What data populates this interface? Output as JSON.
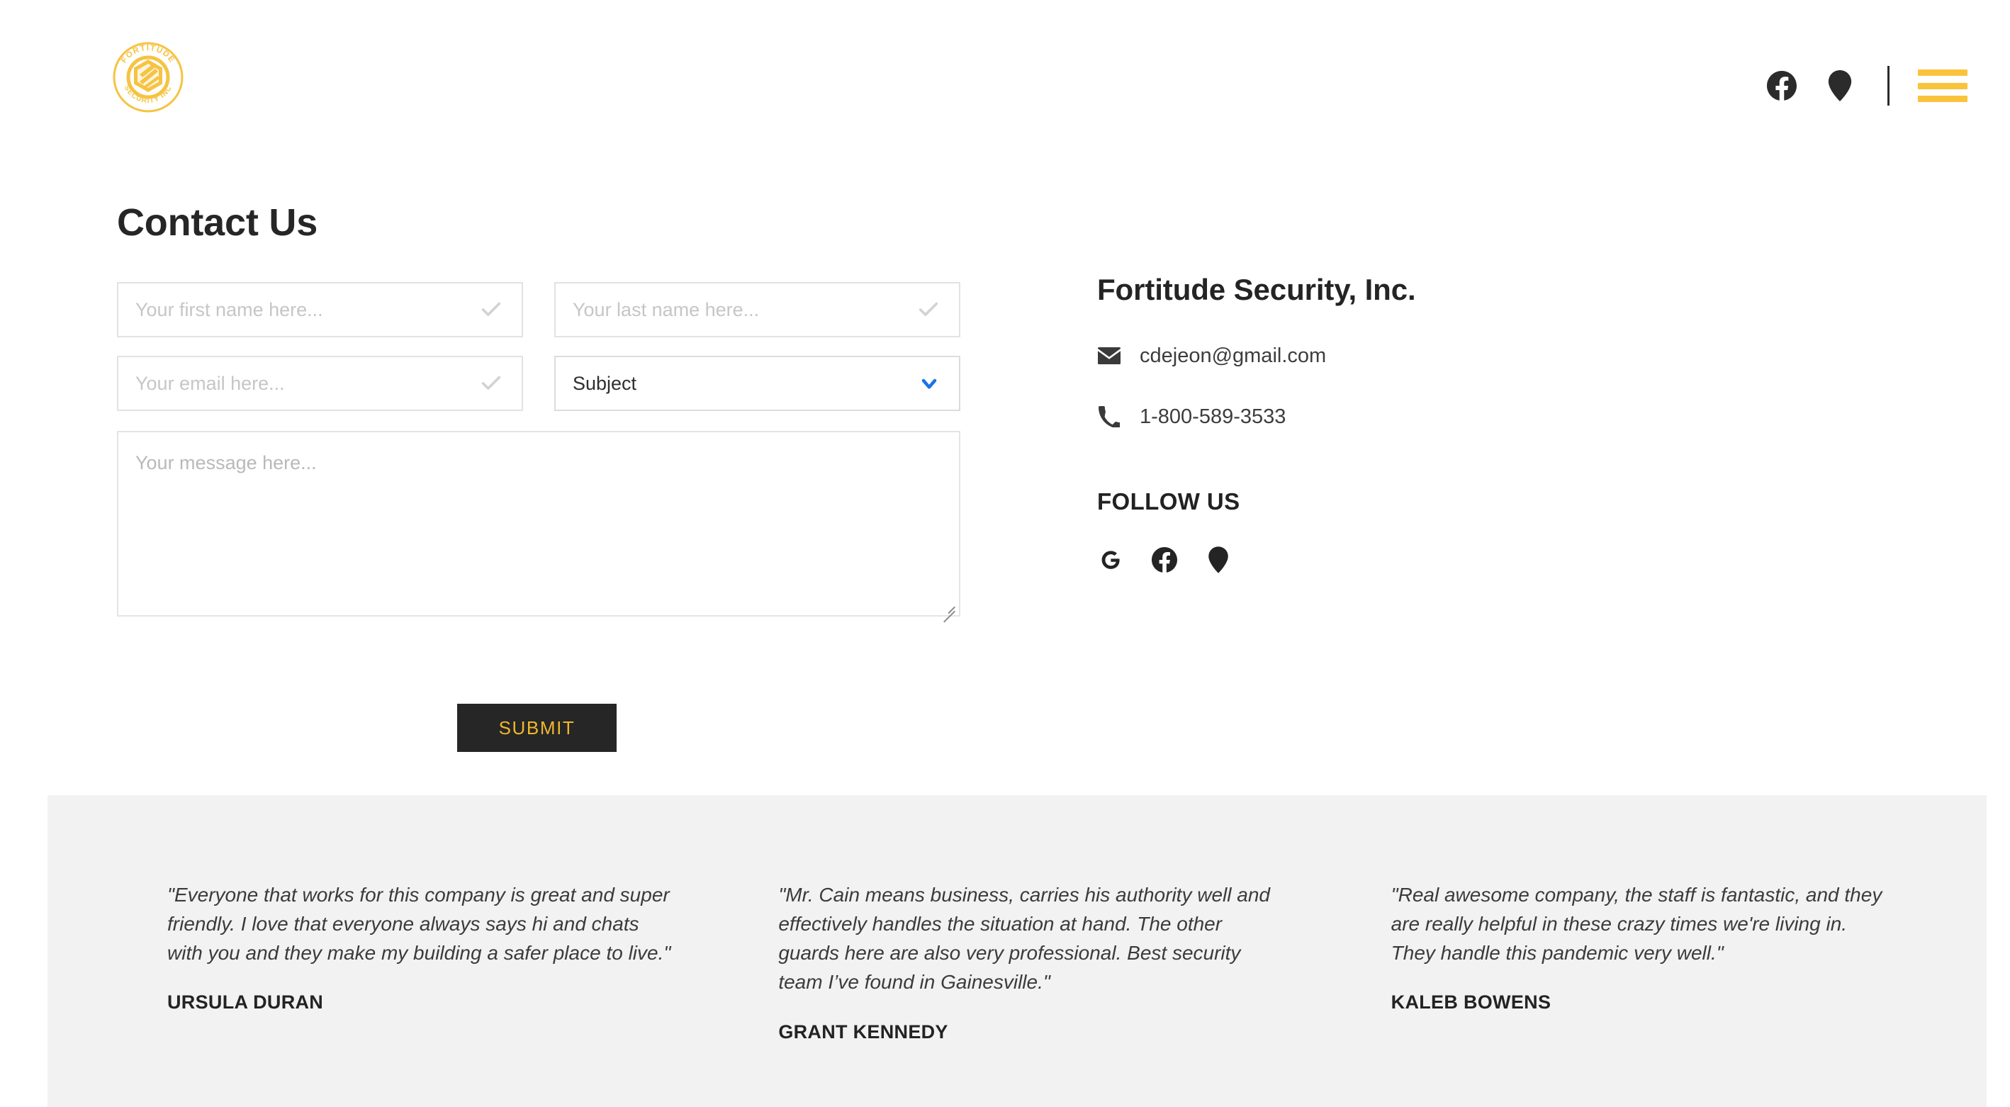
{
  "header": {
    "logo": {
      "top_arc_text": "FORTITUDE",
      "bottom_arc_text": "SECURITY INC",
      "color": "#f6c342"
    },
    "icons": {
      "facebook": "facebook-icon",
      "map_pin": "map-pin-icon",
      "menu": "hamburger-menu-icon"
    },
    "accent_color": "#fac33c"
  },
  "main": {
    "page_title": "Contact Us",
    "form": {
      "first_name_placeholder": "Your first name here...",
      "last_name_placeholder": "Your last name here...",
      "email_placeholder": "Your email here...",
      "subject_value": "Subject",
      "message_placeholder": "Your message here...",
      "submit_label": "SUBMIT",
      "first_name_value": "",
      "last_name_value": "",
      "email_value": "",
      "message_value": "",
      "valid_icon": "check-icon",
      "dropdown_icon": "chevron-down-icon",
      "dropdown_icon_color": "#1a73e8",
      "submit_bg": "#262626",
      "submit_text_color": "#f0b72c"
    }
  },
  "info": {
    "company_name": "Fortitude Security, Inc.",
    "email": "cdejeon@gmail.com",
    "phone": "1-800-589-3533",
    "email_icon": "envelope-icon",
    "phone_icon": "phone-icon",
    "follow_heading": "FOLLOW US",
    "social": [
      {
        "name": "google-icon",
        "label": "Google"
      },
      {
        "name": "facebook-icon",
        "label": "Facebook"
      },
      {
        "name": "map-pin-icon",
        "label": "Map"
      }
    ]
  },
  "testimonials": {
    "background": "#f2f2f2",
    "items": [
      {
        "quote": "\"Everyone that works for this company is great and super friendly. I love that everyone always says hi and chats with you and they make my building a safer place to live.\"",
        "author": "URSULA DURAN"
      },
      {
        "quote": "\"Mr. Cain means business, carries his authority well and effectively handles the situation at hand. The other guards here are also very professional. Best security team I’ve found in Gainesville.\"",
        "author": "GRANT KENNEDY"
      },
      {
        "quote": "\"Real awesome company, the staff is fantastic, and they are really helpful in these crazy times we're living in. They handle this pandemic very well.\"",
        "author": "KALEB BOWENS"
      }
    ]
  }
}
